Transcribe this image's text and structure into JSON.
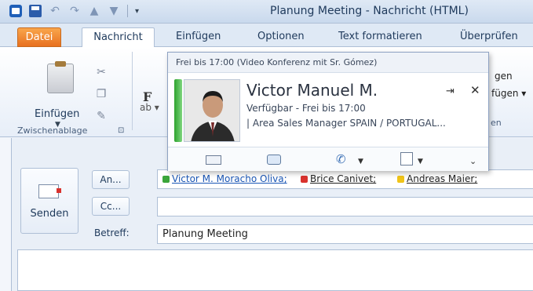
{
  "window": {
    "title": "Planung Meeting - Nachricht (HTML)"
  },
  "qat": {
    "more": "▾"
  },
  "tabs": {
    "file": "Datei",
    "message": "Nachricht",
    "insert": "Einfügen",
    "options": "Optionen",
    "format": "Text formatieren",
    "review": "Überprüfen"
  },
  "ribbon": {
    "paste_label": "Einfügen",
    "clipboard_group": "Zwischenablage",
    "font_f": "F",
    "right_frag1": "gen",
    "right_frag2": "fügen ▾",
    "right_frag3": "en"
  },
  "compose": {
    "send_label": "Senden",
    "to_button": "An...",
    "cc_button": "Cc...",
    "subject_label": "Betreff:",
    "subject_value": "Planung Meeting",
    "recipients": [
      {
        "name": "Victor M. Moracho Oliva;",
        "presence_color": "#3aa53a"
      },
      {
        "name": "Brice Canivet;",
        "presence_color": "#d9322e"
      },
      {
        "name": "Andreas Maier;",
        "presence_color": "#f0c419"
      }
    ]
  },
  "contact_card": {
    "status": "Frei bis 17:00 (Video Konferenz mit Sr. Gómez)",
    "name": "Victor Manuel M.",
    "availability": "Verfügbar - Frei bis 17:00",
    "job_title": "| Area Sales Manager SPAIN / PORTUGAL...",
    "pin_icon": "pin-icon",
    "close_icon": "close-icon"
  }
}
